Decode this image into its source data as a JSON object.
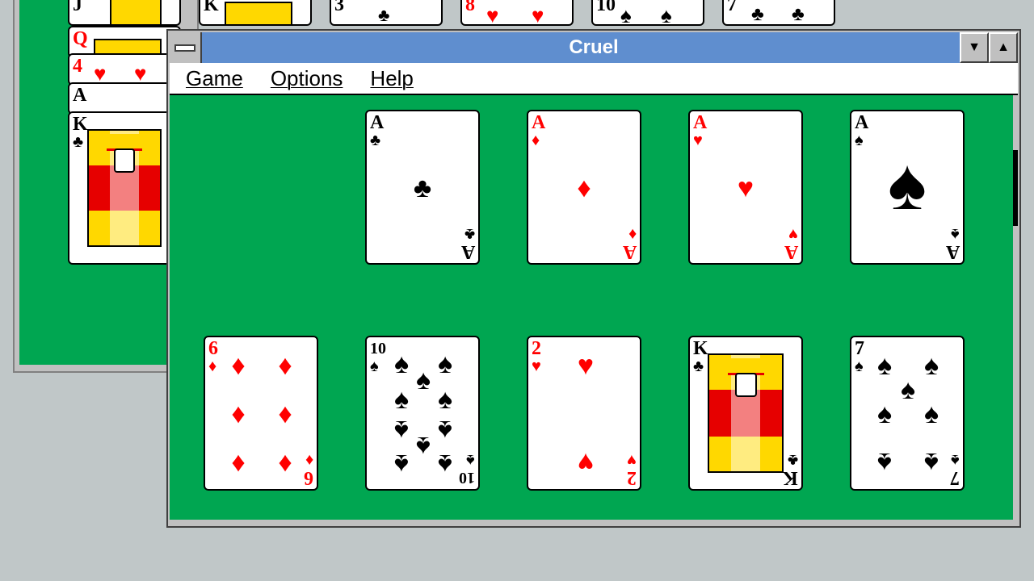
{
  "window": {
    "title": "Cruel"
  },
  "menu": {
    "game": "Game",
    "options": "Options",
    "help": "Help"
  },
  "background_window": {
    "top_row": [
      {
        "rank": "J",
        "suit": "♠",
        "color": "black"
      },
      {
        "rank": "K",
        "suit": "♠",
        "color": "black"
      },
      {
        "rank": "3",
        "suit": "♣",
        "color": "black"
      },
      {
        "rank": "8",
        "suit": "♥",
        "color": "red"
      },
      {
        "rank": "10",
        "suit": "♠",
        "color": "black"
      },
      {
        "rank": "7",
        "suit": "♣",
        "color": "black"
      }
    ],
    "stack": [
      {
        "rank": "Q",
        "suit": "♦",
        "color": "red"
      },
      {
        "rank": "4",
        "suit": "♥",
        "color": "red"
      },
      {
        "rank": "A",
        "suit": "",
        "color": "black"
      },
      {
        "rank": "K",
        "suit": "♣",
        "color": "black"
      }
    ]
  },
  "foundations": [
    {
      "rank": "A",
      "suit": "♣",
      "color": "black"
    },
    {
      "rank": "A",
      "suit": "♦",
      "color": "red"
    },
    {
      "rank": "A",
      "suit": "♥",
      "color": "red"
    },
    {
      "rank": "A",
      "suit": "♠",
      "color": "black"
    }
  ],
  "tableau": [
    {
      "rank": "6",
      "suit": "♦",
      "color": "red"
    },
    {
      "rank": "10",
      "suit": "♠",
      "color": "black"
    },
    {
      "rank": "2",
      "suit": "♥",
      "color": "red"
    },
    {
      "rank": "K",
      "suit": "♣",
      "color": "black"
    },
    {
      "rank": "7",
      "suit": "♠",
      "color": "black"
    }
  ],
  "colors": {
    "felt": "#00a651",
    "titlebar": "#5f8ecf",
    "desktop": "#c0c7c8"
  }
}
